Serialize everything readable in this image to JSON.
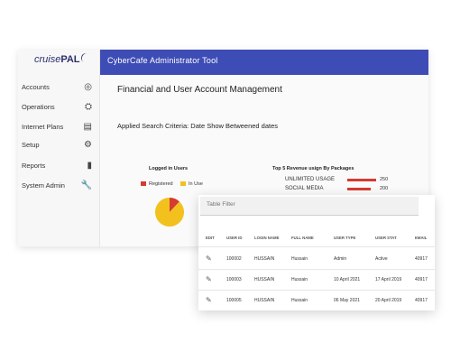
{
  "app": {
    "logo_text": "cruise",
    "logo_bold": "PAL",
    "title": "CyberCafe Administrator Tool"
  },
  "sidebar": {
    "items": [
      {
        "label": "Accounts",
        "icon": "account-circle-icon",
        "glyph": "◎"
      },
      {
        "label": "Operations",
        "icon": "operations-icon",
        "glyph": "⛭"
      },
      {
        "label": "Internet Plans",
        "icon": "plans-icon",
        "glyph": "▤"
      },
      {
        "label": "Setup",
        "icon": "gear-icon",
        "glyph": "⚙"
      },
      {
        "label": "Reports",
        "icon": "bar-chart-icon",
        "glyph": "▮"
      },
      {
        "label": "System Admin",
        "icon": "wrench-icon",
        "glyph": "🔧"
      }
    ]
  },
  "main": {
    "section_title": "Financial and User Account Management",
    "criteria": "Applied Search Criteria: Date Show Betweened dates"
  },
  "logged_chart": {
    "title": "Logged in Users",
    "legend": [
      {
        "label": "Registered",
        "color": "#d53b30"
      },
      {
        "label": "In Use",
        "color": "#f2c11e"
      }
    ]
  },
  "chart_data": [
    {
      "type": "pie",
      "title": "Logged in Users",
      "labels": [
        "Registered",
        "In Use"
      ],
      "values": [
        12,
        88
      ],
      "colors": [
        "#d53b30",
        "#f2c11e"
      ]
    },
    {
      "type": "bar",
      "title": "Top 5 Revenue usign By Packages",
      "categories": [
        "UNLIMITED USAGE",
        "SOCIAL MEDIA"
      ],
      "values": [
        250,
        200
      ],
      "color": "#d53b30"
    }
  ],
  "table": {
    "filter_placeholder": "Table Filter",
    "columns": [
      "EDIT",
      "USER ID",
      "LOGIN NAME",
      "FULL NAME",
      "USER TYPE",
      "USER STAT",
      "EMAIL"
    ],
    "rows": [
      [
        "",
        "100002",
        "HUSSAIN",
        "Hussain",
        "Admin",
        "Active",
        "40917"
      ],
      [
        "",
        "100003",
        "HUSSAIN",
        "Hussain",
        "10 April 2021",
        "17 April 2019",
        "40917"
      ],
      [
        "",
        "100005",
        "HUSSAIN",
        "Hussain",
        "06 May 2021",
        "20 April 2019",
        "40917"
      ]
    ]
  }
}
